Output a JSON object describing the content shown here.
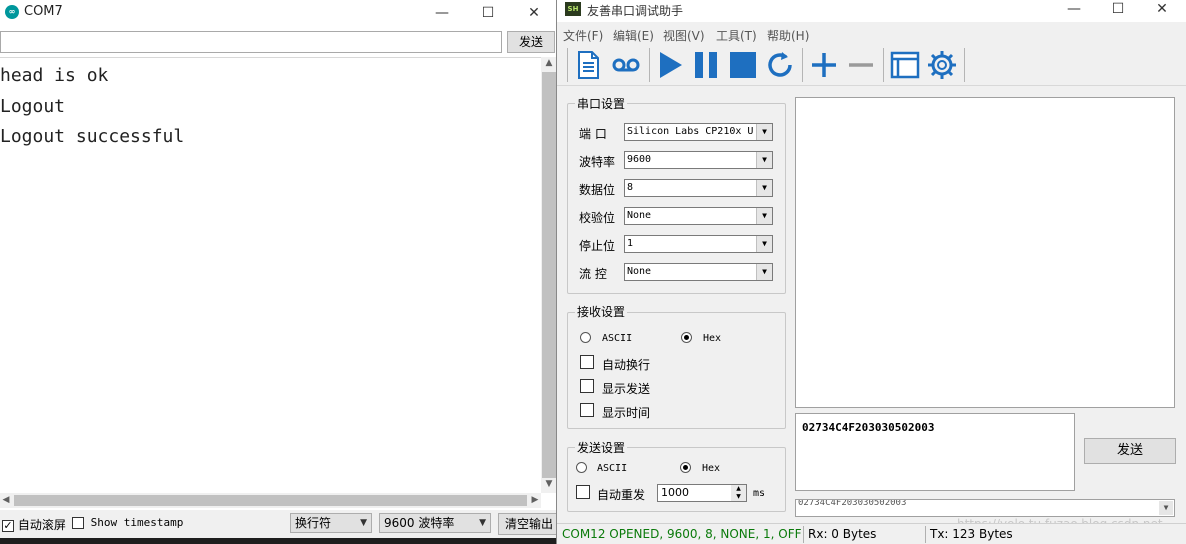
{
  "arduino": {
    "title": "COM7",
    "window_min": "—",
    "window_max": "☐",
    "window_close": "✕",
    "input_value": "",
    "send_label": "发送",
    "output_lines": [
      "head is ok",
      "Logout",
      "Logout successful"
    ],
    "autoscroll_label": "自动滚屏",
    "autoscroll_checked": true,
    "timestamp_label": "Show timestamp",
    "line_ending": "换行符",
    "baud_rate": "9600 波特率",
    "clear_label": "清空输出"
  },
  "serial_tool": {
    "title": "友善串口调试助手",
    "menu": [
      "文件(F)",
      "编辑(E)",
      "视图(V)",
      "工具(T)",
      "帮助(H)"
    ],
    "toolbar": [
      "new-doc-icon",
      "record-icon",
      "play-icon",
      "pause-icon",
      "stop-icon",
      "refresh-icon",
      "plus-icon",
      "minus-icon",
      "window-icon",
      "gear-icon"
    ],
    "port_settings": {
      "title": "串口设置",
      "port_label": "端  口",
      "port_value": "Silicon Labs CP210x U",
      "baud_label": "波特率",
      "baud_value": "9600",
      "databits_label": "数据位",
      "databits_value": "8",
      "parity_label": "校验位",
      "parity_value": "None",
      "stopbits_label": "停止位",
      "stopbits_value": "1",
      "flow_label": "流  控",
      "flow_value": "None"
    },
    "recv_settings": {
      "title": "接收设置",
      "ascii_label": "ASCII",
      "hex_label": "Hex",
      "selected": "Hex",
      "auto_newline_label": "自动换行",
      "show_send_label": "显示发送",
      "show_time_label": "显示时间"
    },
    "send_settings": {
      "title": "发送设置",
      "ascii_label": "ASCII",
      "hex_label": "Hex",
      "selected": "Hex",
      "auto_resend_label": "自动重发",
      "interval_value": "1000",
      "interval_unit": "ms"
    },
    "send_text": "02734C4F203030502003",
    "history_text": "02734C4F203030502003",
    "send_button": "发送",
    "status": {
      "port": "COM12 OPENED, 9600, 8, NONE, 1, OFF",
      "rx": "Rx: 0 Bytes",
      "tx": "Tx: 123 Bytes"
    },
    "watermark": "https://yolo.tu.fuzao.blog.csdn.net",
    "colors": {
      "status_green": "#0a7a0a",
      "tool_blue": "#1e6fc0"
    }
  }
}
